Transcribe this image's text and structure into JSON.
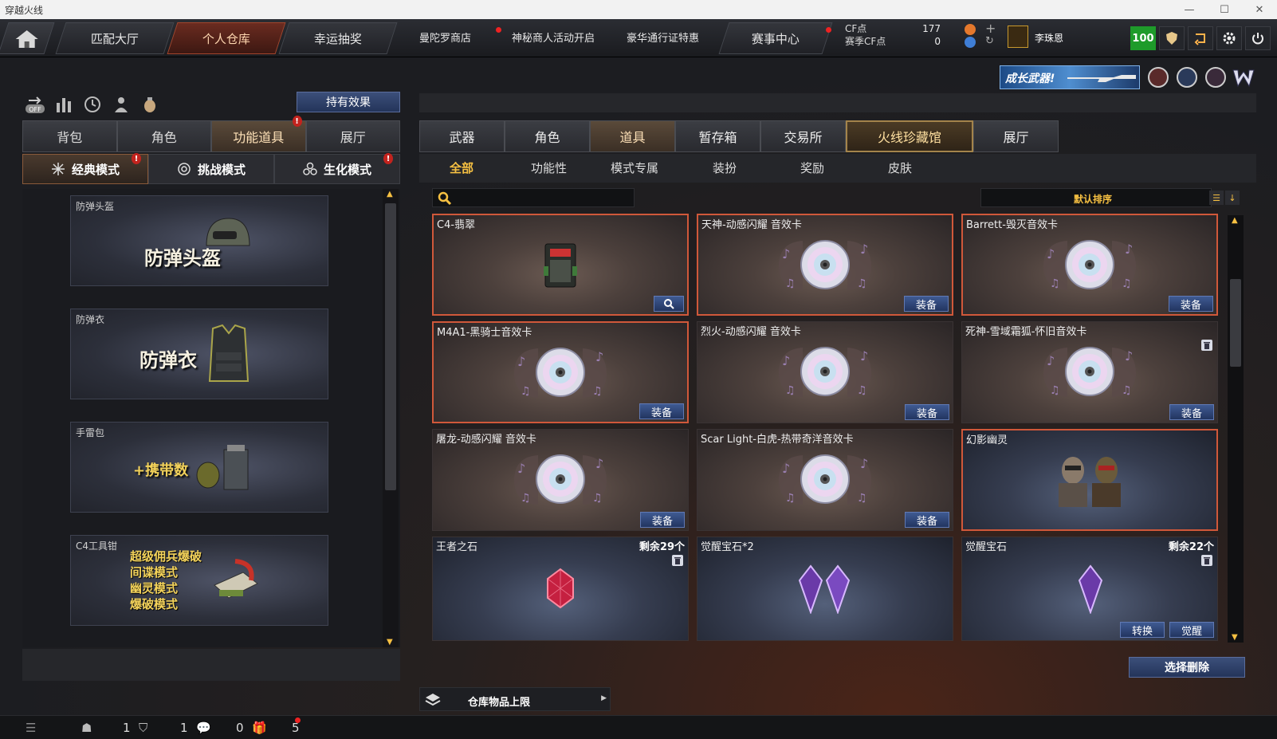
{
  "window": {
    "title": "穿越火线"
  },
  "topnav": {
    "tabs": [
      {
        "label": "匹配大厅"
      },
      {
        "label": "个人仓库"
      },
      {
        "label": "幸运抽奖"
      }
    ],
    "links": [
      "曼陀罗商店",
      "神秘商人活动开启",
      "豪华通行证特惠"
    ],
    "event_tab": "赛事中心",
    "cf_label": "CF点",
    "season_cf_label": "赛季CF点",
    "cf_value": "177",
    "season_cf_value": "0",
    "username": "李珠恩",
    "level": "100"
  },
  "left": {
    "effect_button": "持有效果",
    "tabs": [
      "背包",
      "角色",
      "功能道具",
      "展厅"
    ],
    "modes": [
      "经典模式",
      "挑战模式",
      "生化模式"
    ],
    "items": [
      {
        "caption": "防弹头盔",
        "big_text": "防弹头盔"
      },
      {
        "caption": "防弹衣",
        "big_text": "防弹衣"
      },
      {
        "caption": "手雷包",
        "big_text": "+携带数"
      },
      {
        "caption": "C4工具钳",
        "lines": [
          "超级佣兵爆破",
          "间谍模式",
          "幽灵模式",
          "爆破模式"
        ]
      }
    ]
  },
  "right": {
    "banner_text": "成长武器!",
    "tabs": [
      "武器",
      "角色",
      "道具",
      "暂存箱",
      "交易所",
      "火线珍藏馆",
      "展厅"
    ],
    "subtabs": [
      "全部",
      "功能性",
      "模式专属",
      "装扮",
      "奖励",
      "皮肤"
    ],
    "search_placeholder": "",
    "sort_label": "默认排序",
    "equip_label": "装备",
    "convert_label": "转换",
    "awaken_label": "觉醒",
    "cards": [
      {
        "title": "C4-翡翠"
      },
      {
        "title": "天神-动感闪耀 音效卡"
      },
      {
        "title": "Barrett-毁灭音效卡"
      },
      {
        "title": "M4A1-黑骑士音效卡"
      },
      {
        "title": "烈火-动感闪耀 音效卡"
      },
      {
        "title": "死神-雪域霜狐-怀旧音效卡"
      },
      {
        "title": "屠龙-动感闪耀 音效卡"
      },
      {
        "title": "Scar Light-白虎-热带奇洋音效卡"
      },
      {
        "title": "幻影幽灵"
      },
      {
        "title": "王者之石",
        "remain": "剩余29个"
      },
      {
        "title": "觉醒宝石*2"
      },
      {
        "title": "觉醒宝石",
        "remain": "剩余22个"
      }
    ],
    "select_delete": "选择删除",
    "capacity_label": "仓库物品上限"
  },
  "statusbar": {
    "friends": "1",
    "clan": "1",
    "messages": "0",
    "gifts": "5"
  },
  "colors": {
    "accent_gold": "#f6c042",
    "button_blue": "#24345a",
    "level_green": "#1e9b2a",
    "alert_red": "#c2231e"
  }
}
